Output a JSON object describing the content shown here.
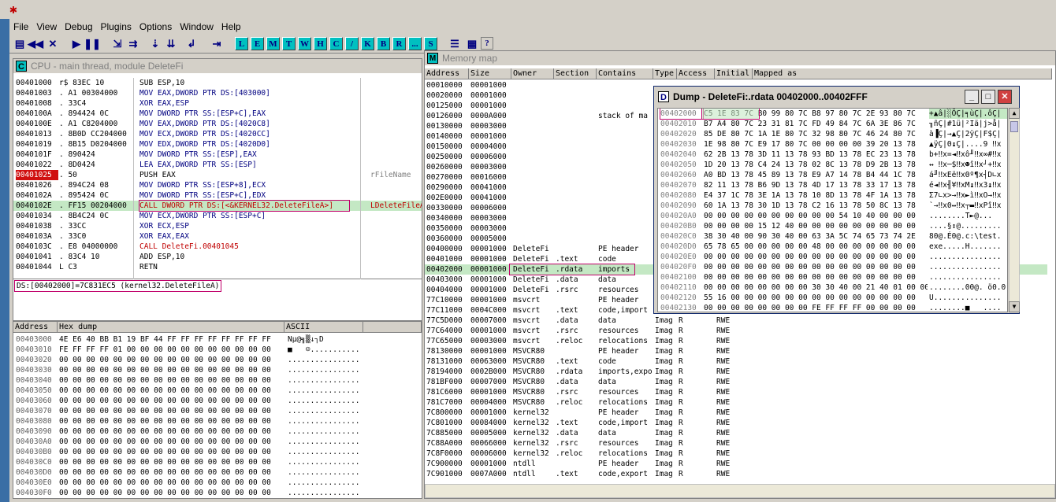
{
  "app": {
    "icon": "ollydbg-bug-icon"
  },
  "menu": [
    "File",
    "View",
    "Debug",
    "Plugins",
    "Options",
    "Window",
    "Help"
  ],
  "toolbar": {
    "letters": [
      "L",
      "E",
      "M",
      "T",
      "W",
      "H",
      "C",
      "/",
      "K",
      "B",
      "R",
      "...",
      "S"
    ],
    "extra": "?"
  },
  "cpu": {
    "title": "CPU - main thread, module DeleteFi",
    "rows": [
      {
        "addr": "00401000",
        "hex": "r$ 83EC 10",
        "asm": "SUB ESP,10",
        "comment": ""
      },
      {
        "addr": "00401003",
        "hex": ". A1 00304000",
        "asm": "MOV EAX,DWORD PTR DS:[403000]",
        "comment": ""
      },
      {
        "addr": "00401008",
        "hex": ". 33C4",
        "asm": "XOR EAX,ESP",
        "comment": ""
      },
      {
        "addr": "0040100A",
        "hex": ". 894424 0C",
        "asm": "MOV DWORD PTR SS:[ESP+C],EAX",
        "comment": ""
      },
      {
        "addr": "0040100E",
        "hex": ". A1 C8204000",
        "asm": "MOV EAX,DWORD PTR DS:[4020C8]",
        "comment": ""
      },
      {
        "addr": "00401013",
        "hex": ". 8B0D CC204000",
        "asm": "MOV ECX,DWORD PTR DS:[4020CC]",
        "comment": ""
      },
      {
        "addr": "00401019",
        "hex": ". 8B15 D0204000",
        "asm": "MOV EDX,DWORD PTR DS:[4020D0]",
        "comment": ""
      },
      {
        "addr": "0040101F",
        "hex": ". 890424",
        "asm": "MOV DWORD PTR SS:[ESP],EAX",
        "comment": ""
      },
      {
        "addr": "00401022",
        "hex": ". 8D0424",
        "asm": "LEA EAX,DWORD PTR SS:[ESP]",
        "comment": ""
      },
      {
        "addr": "00401025",
        "hex": ". 50",
        "asm": "PUSH EAX",
        "comment": "rFileName"
      },
      {
        "addr": "00401026",
        "hex": ". 894C24 08",
        "asm": "MOV DWORD PTR SS:[ESP+8],ECX",
        "comment": ""
      },
      {
        "addr": "0040102A",
        "hex": ". 895424 0C",
        "asm": "MOV DWORD PTR SS:[ESP+C],EDX",
        "comment": ""
      },
      {
        "addr": "0040102E",
        "hex": ". FF15 00204000",
        "asm": "CALL DWORD PTR DS:[<&KERNEL32.DeleteFileA>]",
        "comment": "LDeleteFileA"
      },
      {
        "addr": "00401034",
        "hex": ". 8B4C24 0C",
        "asm": "MOV ECX,DWORD PTR SS:[ESP+C]",
        "comment": ""
      },
      {
        "addr": "00401038",
        "hex": ". 33CC",
        "asm": "XOR ECX,ESP",
        "comment": ""
      },
      {
        "addr": "0040103A",
        "hex": ". 33C0",
        "asm": "XOR EAX,EAX",
        "comment": ""
      },
      {
        "addr": "0040103C",
        "hex": ". E8 04000000",
        "asm": "CALL DeleteFi.00401045",
        "comment": ""
      },
      {
        "addr": "00401041",
        "hex": ". 83C4 10",
        "asm": "ADD ESP,10",
        "comment": ""
      },
      {
        "addr": "00401044",
        "hex": "L C3",
        "asm": "RETN",
        "comment": ""
      }
    ],
    "info": "DS:[00402000]=7C831EC5 (kernel32.DeleteFileA)"
  },
  "hexdump": {
    "headers": [
      "Address",
      "Hex dump",
      "ASCII"
    ],
    "rows": [
      {
        "addr": "00403000",
        "hex": "4E E6 40 BB B1 19 BF 44 FF FF FF FF FF FF FF FF",
        "ascii": "Nµ@╗▒↓┐D"
      },
      {
        "addr": "00403010",
        "hex": "FE FF FF FF 01 00 00 00 00 00 00 00 00 00 00 00",
        "ascii": "■   ☺..........."
      },
      {
        "addr": "00403020",
        "hex": "00 00 00 00 00 00 00 00 00 00 00 00 00 00 00 00",
        "ascii": "................"
      },
      {
        "addr": "00403030",
        "hex": "00 00 00 00 00 00 00 00 00 00 00 00 00 00 00 00",
        "ascii": "................"
      },
      {
        "addr": "00403040",
        "hex": "00 00 00 00 00 00 00 00 00 00 00 00 00 00 00 00",
        "ascii": "................"
      },
      {
        "addr": "00403050",
        "hex": "00 00 00 00 00 00 00 00 00 00 00 00 00 00 00 00",
        "ascii": "................"
      },
      {
        "addr": "00403060",
        "hex": "00 00 00 00 00 00 00 00 00 00 00 00 00 00 00 00",
        "ascii": "................"
      },
      {
        "addr": "00403070",
        "hex": "00 00 00 00 00 00 00 00 00 00 00 00 00 00 00 00",
        "ascii": "................"
      },
      {
        "addr": "00403080",
        "hex": "00 00 00 00 00 00 00 00 00 00 00 00 00 00 00 00",
        "ascii": "................"
      },
      {
        "addr": "00403090",
        "hex": "00 00 00 00 00 00 00 00 00 00 00 00 00 00 00 00",
        "ascii": "................"
      },
      {
        "addr": "004030A0",
        "hex": "00 00 00 00 00 00 00 00 00 00 00 00 00 00 00 00",
        "ascii": "................"
      },
      {
        "addr": "004030B0",
        "hex": "00 00 00 00 00 00 00 00 00 00 00 00 00 00 00 00",
        "ascii": "................"
      },
      {
        "addr": "004030C0",
        "hex": "00 00 00 00 00 00 00 00 00 00 00 00 00 00 00 00",
        "ascii": "................"
      },
      {
        "addr": "004030D0",
        "hex": "00 00 00 00 00 00 00 00 00 00 00 00 00 00 00 00",
        "ascii": "................"
      },
      {
        "addr": "004030E0",
        "hex": "00 00 00 00 00 00 00 00 00 00 00 00 00 00 00 00",
        "ascii": "................"
      },
      {
        "addr": "004030F0",
        "hex": "00 00 00 00 00 00 00 00 00 00 00 00 00 00 00 00",
        "ascii": "................"
      }
    ]
  },
  "memmap": {
    "title": "Memory map",
    "headers": [
      "Address",
      "Size",
      "Owner",
      "Section",
      "Contains",
      "Type",
      "Access",
      "Initial",
      "Mapped as"
    ],
    "rows": [
      [
        "00010000",
        "00001000",
        "",
        "",
        "",
        "",
        "",
        "",
        ""
      ],
      [
        "00020000",
        "00001000",
        "",
        "",
        "",
        "",
        "",
        "",
        ""
      ],
      [
        "00125000",
        "00001000",
        "",
        "",
        "",
        "",
        "",
        "",
        ""
      ],
      [
        "00126000",
        "0000A000",
        "",
        "",
        "stack of ma",
        "",
        "",
        "",
        ""
      ],
      [
        "00130000",
        "00003000",
        "",
        "",
        "",
        "",
        "",
        "",
        ""
      ],
      [
        "00140000",
        "00001000",
        "",
        "",
        "",
        "",
        "",
        "",
        ""
      ],
      [
        "00150000",
        "00004000",
        "",
        "",
        "",
        "",
        "",
        "",
        ""
      ],
      [
        "00250000",
        "00006000",
        "",
        "",
        "",
        "",
        "",
        "",
        ""
      ],
      [
        "00260000",
        "00003000",
        "",
        "",
        "",
        "",
        "",
        "",
        ""
      ],
      [
        "00270000",
        "00016000",
        "",
        "",
        "",
        "",
        "",
        "",
        ""
      ],
      [
        "00290000",
        "00041000",
        "",
        "",
        "",
        "",
        "",
        "",
        ""
      ],
      [
        "002E0000",
        "00041000",
        "",
        "",
        "",
        "",
        "",
        "",
        ""
      ],
      [
        "00330000",
        "00006000",
        "",
        "",
        "",
        "",
        "",
        "",
        ""
      ],
      [
        "00340000",
        "00003000",
        "",
        "",
        "",
        "",
        "",
        "",
        ""
      ],
      [
        "00350000",
        "00003000",
        "",
        "",
        "",
        "",
        "",
        "",
        ""
      ],
      [
        "00360000",
        "00005000",
        "",
        "",
        "",
        "",
        "",
        "",
        ""
      ],
      [
        "00400000",
        "00001000",
        "DeleteFi",
        "",
        "PE header",
        "",
        "",
        "",
        ""
      ],
      [
        "00401000",
        "00001000",
        "DeleteFi",
        ".text",
        "code",
        "",
        "",
        "",
        ""
      ],
      [
        "00402000",
        "00001000",
        "DeleteFi",
        ".rdata",
        "imports",
        "",
        "",
        "",
        ""
      ],
      [
        "00403000",
        "00001000",
        "DeleteFi",
        ".data",
        "data",
        "",
        "",
        "",
        ""
      ],
      [
        "00404000",
        "00001000",
        "DeleteFi",
        ".rsrc",
        "resources",
        "",
        "",
        "",
        ""
      ],
      [
        "77C10000",
        "00001000",
        "msvcrt",
        "",
        "PE header",
        "",
        "",
        "",
        ""
      ],
      [
        "77C11000",
        "0004C000",
        "msvcrt",
        ".text",
        "code,import",
        "",
        "",
        "",
        ""
      ],
      [
        "77C5D000",
        "00007000",
        "msvcrt",
        ".data",
        "data",
        "Imag",
        "R",
        "RWE",
        ""
      ],
      [
        "77C64000",
        "00001000",
        "msvcrt",
        ".rsrc",
        "resources",
        "Imag",
        "R",
        "RWE",
        ""
      ],
      [
        "77C65000",
        "00003000",
        "msvcrt",
        ".reloc",
        "relocations",
        "Imag",
        "R",
        "RWE",
        ""
      ],
      [
        "78130000",
        "00001000",
        "MSVCR80",
        "",
        "PE header",
        "Imag",
        "R",
        "RWE",
        ""
      ],
      [
        "78131000",
        "00063000",
        "MSVCR80",
        ".text",
        "code",
        "Imag",
        "R",
        "RWE",
        ""
      ],
      [
        "78194000",
        "0002B000",
        "MSVCR80",
        ".rdata",
        "imports,expo",
        "Imag",
        "R",
        "RWE",
        ""
      ],
      [
        "781BF000",
        "00007000",
        "MSVCR80",
        ".data",
        "data",
        "Imag",
        "R",
        "RWE",
        ""
      ],
      [
        "781C6000",
        "00001000",
        "MSVCR80",
        ".rsrc",
        "resources",
        "Imag",
        "R",
        "RWE",
        ""
      ],
      [
        "781C7000",
        "00004000",
        "MSVCR80",
        ".reloc",
        "relocations",
        "Imag",
        "R",
        "RWE",
        ""
      ],
      [
        "7C800000",
        "00001000",
        "kernel32",
        "",
        "PE header",
        "Imag",
        "R",
        "RWE",
        ""
      ],
      [
        "7C801000",
        "00084000",
        "kernel32",
        ".text",
        "code,import",
        "Imag",
        "R",
        "RWE",
        ""
      ],
      [
        "7C885000",
        "00005000",
        "kernel32",
        ".data",
        "data",
        "Imag",
        "R",
        "RWE",
        ""
      ],
      [
        "7C88A000",
        "00066000",
        "kernel32",
        ".rsrc",
        "resources",
        "Imag",
        "R",
        "RWE",
        ""
      ],
      [
        "7C8F0000",
        "00006000",
        "kernel32",
        ".reloc",
        "relocations",
        "Imag",
        "R",
        "RWE",
        ""
      ],
      [
        "7C900000",
        "00001000",
        "ntdll",
        "",
        "PE header",
        "Imag",
        "R",
        "RWE",
        ""
      ],
      [
        "7C901000",
        "0007A000",
        "ntdll",
        ".text",
        "code,export",
        "Imag",
        "R",
        "RWE",
        ""
      ]
    ]
  },
  "dump": {
    "title": "Dump - DeleteFi:.rdata 00402000..00402FFF",
    "rows": [
      {
        "addr": "00402000",
        "hex": "C5 1E 83 7C B0 99 80 7C B8 97 80 7C 2E 93 80 7C",
        "ascii": "+▲â|░ÖÇ|╕ùÇ|.ôÇ|"
      },
      {
        "addr": "00402010",
        "hex": "B7 A4 80 7C 23 31 81 7C FD 49 84 7C 6A 3E 86 7C",
        "ascii": "╖ñÇ|#1ü|²Iä|j>å|"
      },
      {
        "addr": "00402020",
        "hex": "85 DE 80 7C 1A 1E 80 7C 32 98 80 7C 46 24 80 7C",
        "ascii": "à▐Ç|→▲Ç|2ÿÇ|F$Ç|"
      },
      {
        "addr": "00402030",
        "hex": "1E 98 80 7C E9 17 80 7C 00 00 00 00 39 20 13 78",
        "ascii": "▲ÿÇ|Θ↨Ç|....9 ‼x"
      },
      {
        "addr": "00402040",
        "hex": "62 2B 13 78 3D 11 13 78 93 BD 13 78 EC 23 13 78",
        "ascii": "b+‼x=◄‼xô╜‼x∞#‼x"
      },
      {
        "addr": "00402050",
        "hex": "1D 20 13 78 C4 24 13 78 02 8C 13 78 D9 2B 13 78",
        "ascii": "↔ ‼x─$‼x☻î‼x┘+‼x"
      },
      {
        "addr": "00402060",
        "hex": "A0 BD 13 78 45 89 13 78 E9 A7 14 78 B4 44 1C 78",
        "ascii": "á╜‼xEë‼xΘº¶x┤D∟x"
      },
      {
        "addr": "00402070",
        "hex": "82 11 13 78 B6 9D 13 78 4D 17 13 78 33 17 13 78",
        "ascii": "é◄‼x╢¥‼xM↨‼x3↨‼x"
      },
      {
        "addr": "00402080",
        "hex": "E4 37 1C 78 3E 1A 13 78 10 8D 13 78 4F 1A 13 78",
        "ascii": "Σ7∟x>→‼x►ì‼xO→‼x"
      },
      {
        "addr": "00402090",
        "hex": "60 1A 13 78 30 1D 13 78 C2 16 13 78 50 8C 13 78",
        "ascii": "`→‼x0↔‼x┬▬‼xPî‼x"
      },
      {
        "addr": "004020A0",
        "hex": "00 00 00 00 00 00 00 00 00 00 54 10 40 00 00 00",
        "ascii": "........T►@..."
      },
      {
        "addr": "004020B0",
        "hex": "00 00 00 00 15 12 40 00 00 00 00 00 00 00 00 00",
        "ascii": "....§↕@........."
      },
      {
        "addr": "004020C0",
        "hex": "38 30 40 00 90 30 40 00 63 3A 5C 74 65 73 74 2E",
        "ascii": "80@.É0@.c:\\test."
      },
      {
        "addr": "004020D0",
        "hex": "65 78 65 00 00 00 00 00 48 00 00 00 00 00 00 00",
        "ascii": "exe.....H......."
      },
      {
        "addr": "004020E0",
        "hex": "00 00 00 00 00 00 00 00 00 00 00 00 00 00 00 00",
        "ascii": "................"
      },
      {
        "addr": "004020F0",
        "hex": "00 00 00 00 00 00 00 00 00 00 00 00 00 00 00 00",
        "ascii": "................"
      },
      {
        "addr": "00402100",
        "hex": "00 00 00 00 00 00 00 00 00 00 00 00 00 00 00 00",
        "ascii": "................"
      },
      {
        "addr": "00402110",
        "hex": "00 00 00 00 00 00 00 00 30 30 40 00 21 40 01 00 00 00",
        "ascii": "........00@. ö0.0.."
      },
      {
        "addr": "00402120",
        "hex": "55 16 00 00 00 00 00 00 00 00 00 00 00 00 00 00",
        "ascii": "U..............."
      },
      {
        "addr": "00402130",
        "hex": "00 00 00 00 00 00 00 00 FE FF FF FF 00 00 00 00",
        "ascii": "........■   ...."
      }
    ]
  }
}
